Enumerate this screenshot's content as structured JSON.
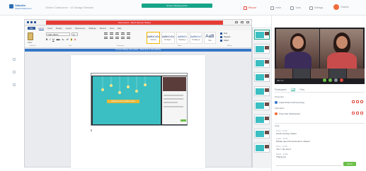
{
  "header": {
    "logo_line1": "Vaikuntha",
    "logo_line2": "Virtual Classroom",
    "session_title": "Online Classroom · UI Design Session",
    "share_label": "Screen Sharing Active",
    "actions": [
      {
        "label": "Record",
        "icon": "record-icon",
        "red": true
      },
      {
        "label": "Invite",
        "icon": "invite-icon",
        "red": false
      },
      {
        "label": "Tools",
        "icon": "tools-icon",
        "red": false
      },
      {
        "label": "Settings",
        "icon": "gear-icon",
        "red": false
      }
    ],
    "user_name": "Teacher",
    "accent_color": "#17a589",
    "record_color": "#e0463c"
  },
  "word": {
    "title_bar": "Document1 - Word  (Screen Share)",
    "tabs": [
      "File",
      "Home",
      "Insert",
      "Design",
      "Layout",
      "References",
      "Mailings",
      "Review",
      "View",
      "Help"
    ],
    "active_tab": "Home",
    "clipboard_label": "Paste",
    "font_name": "Calibri (Body)",
    "font_size": "11",
    "format_buttons": [
      "B",
      "I",
      "U",
      "abc",
      "x₂",
      "x²",
      "A",
      "A"
    ],
    "styles": [
      {
        "sample": "AaBbCcDc",
        "name": "Normal"
      },
      {
        "sample": "AaBbCcDc",
        "name": "No Spac..."
      },
      {
        "sample": "AaBbCc",
        "name": "Heading 1"
      },
      {
        "sample": "AaBbCcC",
        "name": "Heading 2"
      },
      {
        "sample": "AaB",
        "name": "Title"
      }
    ],
    "editing": [
      "Find",
      "Replace",
      "Select"
    ],
    "groups": [
      "Clipboard",
      "Font",
      "Paragraph",
      "Styles",
      "Editing"
    ],
    "notice": "You are sharing your screen · Click here to stop sharing",
    "pasted_label": "Welcome to the Online Class",
    "cursor": "¶"
  },
  "panel": {
    "mic_label": "Mic On",
    "tabs": [
      "Participants",
      "Chat",
      "Files"
    ],
    "active_tab": "Chat",
    "section_presenter": "Presenter",
    "presenter_name": "Anjali Sharma (Presenting)",
    "section_attendees": "Attendees",
    "attendee_name": "Priya Nair (Participant)",
    "chat_title": "Chat",
    "messages": [
      {
        "who": "Priya · 10:02",
        "text": "Good morning ma'am"
      },
      {
        "who": "Anjali · 10:03",
        "text": "Please open the document I shared"
      },
      {
        "who": "Priya · 10:05",
        "text": "Yes, I can see it"
      },
      {
        "who": "Rahul · 10:06",
        "text": "Thank you"
      }
    ],
    "send_label": "Send"
  }
}
